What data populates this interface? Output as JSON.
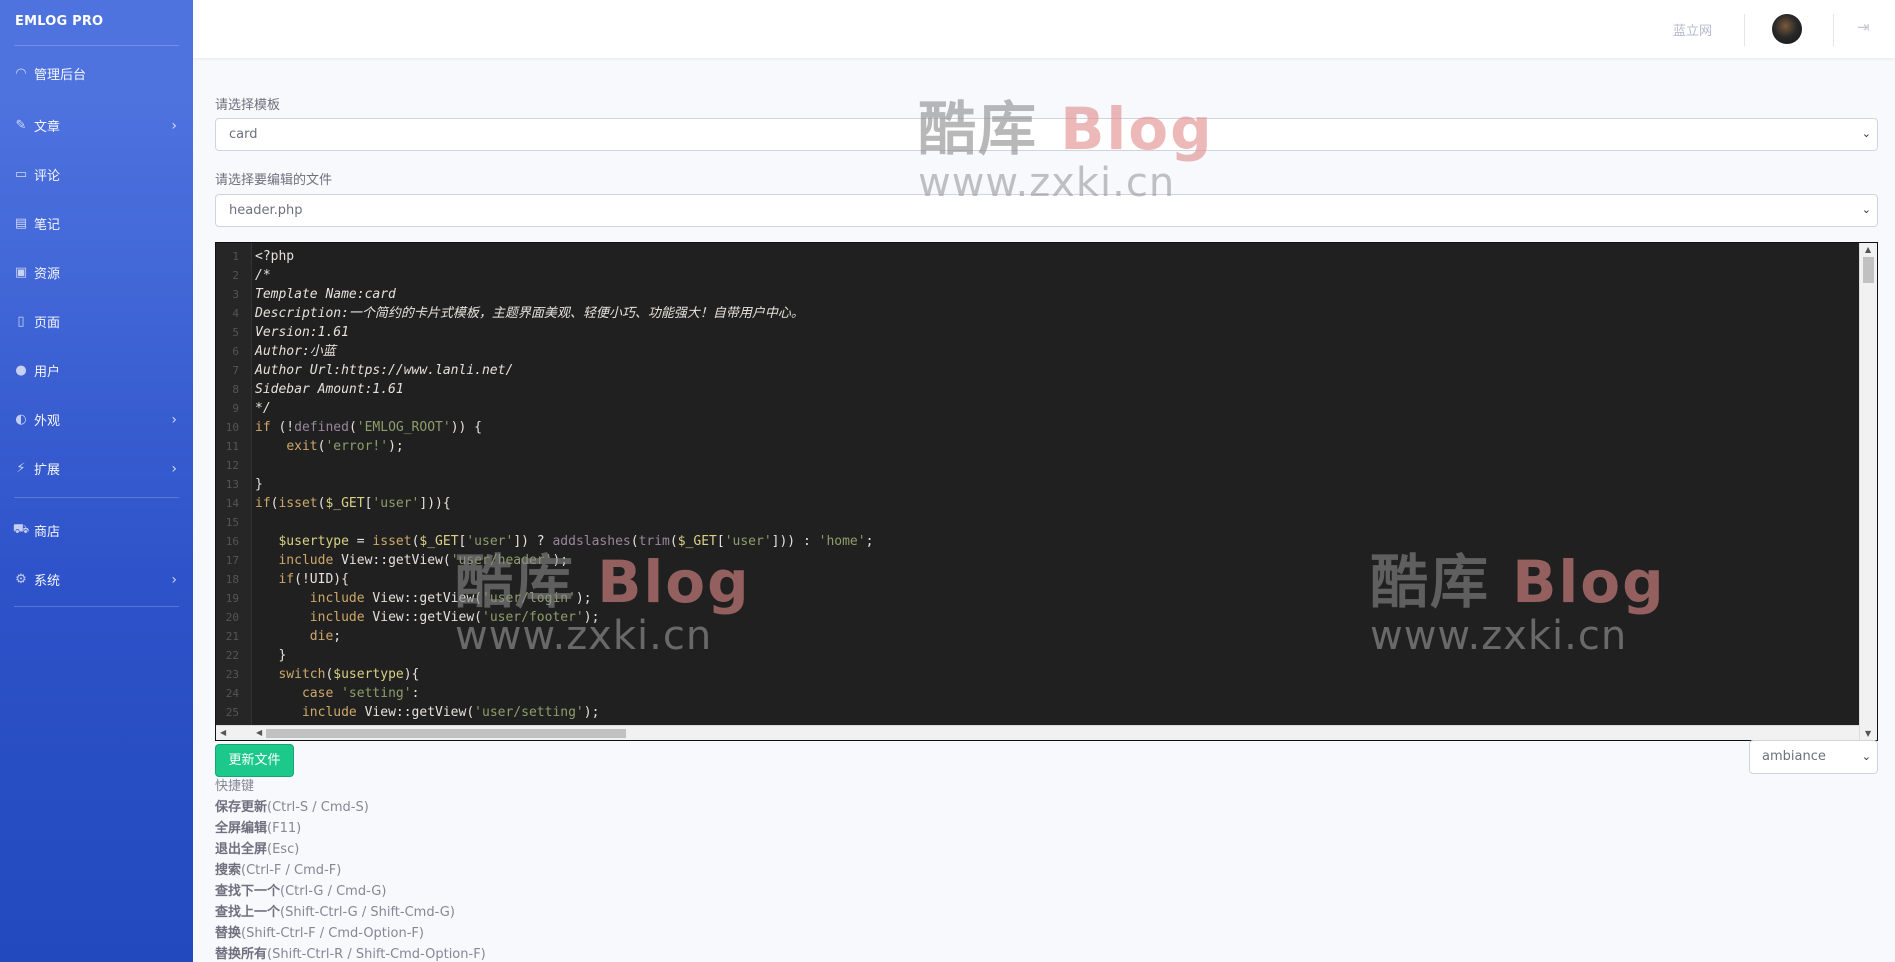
{
  "sidebar": {
    "brand": "EMLOG PRO",
    "items": [
      {
        "label": "管理后台",
        "icon": "dashboard-icon",
        "chevron": false
      },
      {
        "label": "文章",
        "icon": "pen-icon",
        "chevron": true
      },
      {
        "label": "评论",
        "icon": "comment-icon",
        "chevron": false
      },
      {
        "label": "笔记",
        "icon": "note-icon",
        "chevron": false
      },
      {
        "label": "资源",
        "icon": "image-icon",
        "chevron": false
      },
      {
        "label": "页面",
        "icon": "file-icon",
        "chevron": false
      },
      {
        "label": "用户",
        "icon": "user-icon",
        "chevron": false
      },
      {
        "label": "外观",
        "icon": "palette-icon",
        "chevron": true
      },
      {
        "label": "扩展",
        "icon": "plug-icon",
        "chevron": true
      },
      {
        "label": "商店",
        "icon": "cart-icon",
        "chevron": false
      },
      {
        "label": "系统",
        "icon": "gear-icon",
        "chevron": true
      }
    ]
  },
  "topbar": {
    "site_link": "蓝立网",
    "logout_icon": "logout-icon"
  },
  "form": {
    "template_label": "请选择模板",
    "template_value": "card",
    "file_label": "请选择要编辑的文件",
    "file_value": "header.php"
  },
  "editor": {
    "lines": [
      {
        "n": "1",
        "code": "<?php",
        "cls": "c-tag"
      },
      {
        "n": "2",
        "code": "/*",
        "cls": "c-com"
      },
      {
        "n": "3",
        "code": "Template Name:card",
        "cls": "c-com"
      },
      {
        "n": "4",
        "code": "Description:一个简约的卡片式模板，主题界面美观、轻便小巧、功能强大！自带用户中心。",
        "cls": "c-com"
      },
      {
        "n": "5",
        "code": "Version:1.61",
        "cls": "c-com"
      },
      {
        "n": "6",
        "code": "Author:小蓝",
        "cls": "c-com"
      },
      {
        "n": "7",
        "code": "Author Url:https://www.lanli.net/",
        "cls": "c-com"
      },
      {
        "n": "8",
        "code": "Sidebar Amount:1.61",
        "cls": "c-com"
      },
      {
        "n": "9",
        "code": "*/",
        "cls": "c-com"
      },
      {
        "n": "10",
        "code": "if (!defined('EMLOG_ROOT')) {",
        "cls": ""
      },
      {
        "n": "11",
        "code": "    exit('error!');",
        "cls": ""
      },
      {
        "n": "12",
        "code": "",
        "cls": ""
      },
      {
        "n": "13",
        "code": "}",
        "cls": ""
      },
      {
        "n": "14",
        "code": "if(isset($_GET['user'])){",
        "cls": ""
      },
      {
        "n": "15",
        "code": "",
        "cls": ""
      },
      {
        "n": "16",
        "code": "   $usertype = isset($_GET['user']) ? addslashes(trim($_GET['user'])) : 'home';",
        "cls": ""
      },
      {
        "n": "17",
        "code": "   include View::getView('user/header');",
        "cls": ""
      },
      {
        "n": "18",
        "code": "   if(!UID){",
        "cls": ""
      },
      {
        "n": "19",
        "code": "       include View::getView('user/login');",
        "cls": ""
      },
      {
        "n": "20",
        "code": "       include View::getView('user/footer');",
        "cls": ""
      },
      {
        "n": "21",
        "code": "       die;",
        "cls": ""
      },
      {
        "n": "22",
        "code": "   }",
        "cls": ""
      },
      {
        "n": "23",
        "code": "   switch($usertype){",
        "cls": ""
      },
      {
        "n": "24",
        "code": "      case 'setting':",
        "cls": ""
      },
      {
        "n": "25",
        "code": "      include View::getView('user/setting');",
        "cls": ""
      }
    ]
  },
  "actions": {
    "save_label": "更新文件",
    "theme_value": "ambiance"
  },
  "shortcuts": {
    "title": "快捷键",
    "items": [
      {
        "name": "保存更新",
        "keys": "(Ctrl-S / Cmd-S)"
      },
      {
        "name": "全屏编辑",
        "keys": "(F11)"
      },
      {
        "name": "退出全屏",
        "keys": "(Esc)"
      },
      {
        "name": "搜索",
        "keys": "(Ctrl-F / Cmd-F)"
      },
      {
        "name": "查找下一个",
        "keys": "(Ctrl-G / Cmd-G)"
      },
      {
        "name": "查找上一个",
        "keys": "(Shift-Ctrl-G / Shift-Cmd-G)"
      },
      {
        "name": "替换",
        "keys": "(Shift-Ctrl-F / Cmd-Option-F)"
      },
      {
        "name": "替换所有",
        "keys": "(Shift-Ctrl-R / Shift-Cmd-Option-F)"
      }
    ]
  },
  "watermark": {
    "cn": "酷库",
    "blog": "Blog",
    "url": "www.zxki.cn"
  }
}
